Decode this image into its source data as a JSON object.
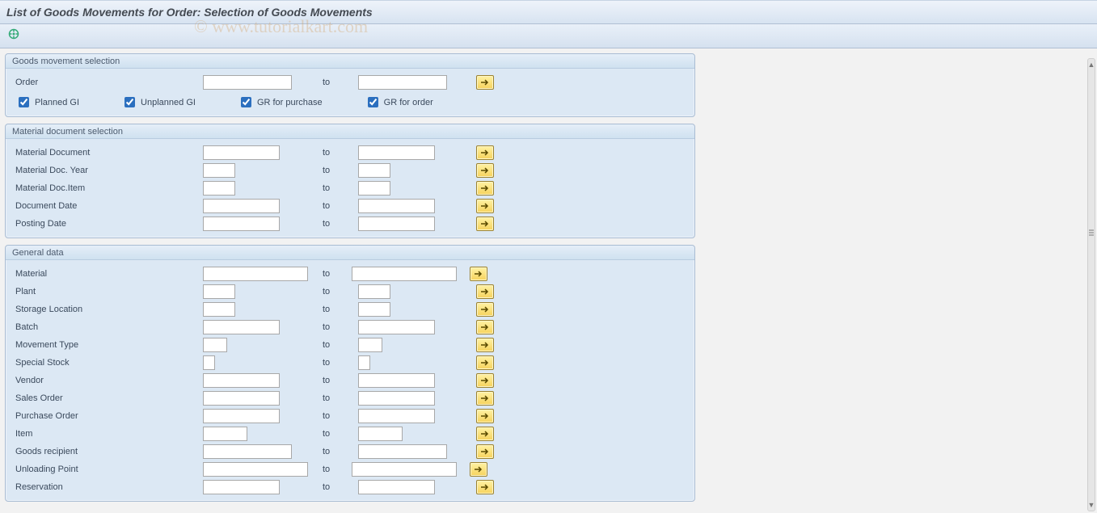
{
  "title": "List of Goods Movements for Order: Selection of Goods Movements",
  "watermark": "© www.tutorialkart.com",
  "labels": {
    "to": "to"
  },
  "group1": {
    "header": "Goods movement selection",
    "order_label": "Order",
    "cb_planned": "Planned GI",
    "cb_unplanned": "Unplanned GI",
    "cb_gr_purchase": "GR for purchase",
    "cb_gr_order": "GR for order"
  },
  "group2": {
    "header": "Material document selection",
    "matdoc": "Material Document",
    "matyear": "Material Doc. Year",
    "matitem": "Material Doc.Item",
    "docdate": "Document Date",
    "postdate": "Posting Date"
  },
  "group3": {
    "header": "General data",
    "material": "Material",
    "plant": "Plant",
    "storloc": "Storage Location",
    "batch": "Batch",
    "movtype": "Movement Type",
    "spstock": "Special Stock",
    "vendor": "Vendor",
    "salesord": "Sales Order",
    "purord": "Purchase Order",
    "item": "Item",
    "goodsrec": "Goods recipient",
    "unload": "Unloading Point",
    "reserv": "Reservation"
  }
}
